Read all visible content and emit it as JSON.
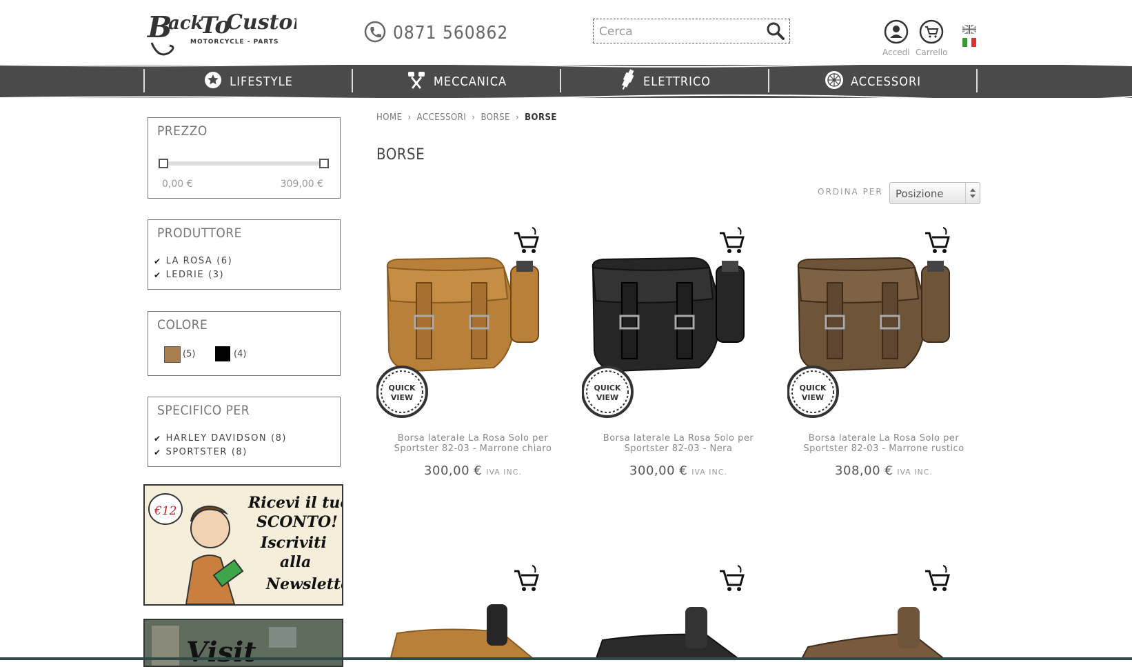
{
  "header": {
    "logo_text": "BackToCustom",
    "logo_tagline": "MOTORCYCLE - PARTS",
    "phone": "0871 560862",
    "search_placeholder": "Cerca",
    "account_label": "Accedi",
    "cart_label": "Carrello",
    "languages": [
      "en",
      "it"
    ]
  },
  "nav": {
    "items": [
      {
        "label": "LIFESTYLE",
        "icon": "star-badge-icon"
      },
      {
        "label": "MECCANICA",
        "icon": "crossed-pistons-icon"
      },
      {
        "label": "ELETTRICO",
        "icon": "spark-plug-icon"
      },
      {
        "label": "ACCESSORI",
        "icon": "wheel-icon"
      }
    ]
  },
  "sidebar": {
    "price": {
      "title": "PREZZO",
      "min": "0,00 €",
      "max": "309,00 €"
    },
    "manufacturer": {
      "title": "PRODUTTORE",
      "items": [
        {
          "label": "LA ROSA",
          "count": "(6)"
        },
        {
          "label": "LEDRIE",
          "count": "(3)"
        }
      ]
    },
    "color": {
      "title": "COLORE",
      "items": [
        {
          "color": "#a8804f",
          "count": "(5)"
        },
        {
          "color": "#000000",
          "count": "(4)"
        }
      ]
    },
    "specific": {
      "title": "SPECIFICO PER",
      "items": [
        {
          "label": "HARLEY DAVIDSON",
          "count": "(8)"
        },
        {
          "label": "SPORTSTER",
          "count": "(8)"
        }
      ]
    },
    "newsletter_banner": {
      "badge": "€12",
      "line1": "Ricevi il tuo",
      "line2": "SCONTO!",
      "line3": "Iscriviti",
      "line4": "alla",
      "line5": "Newsletter"
    },
    "visit_banner": {
      "text": "Visit"
    }
  },
  "main": {
    "breadcrumb": [
      "HOME",
      "ACCESSORI",
      "BORSE",
      "BORSE"
    ],
    "title": "BORSE",
    "sort_label": "ORDINA PER",
    "sort_value": "Posizione",
    "quick_view": "QUICK VIEW",
    "vat_label": "IVA INC.",
    "products": [
      {
        "name": "Borsa laterale La Rosa Solo per Sportster 82-03 - Marrone chiaro",
        "price": "300,00 €",
        "color": "#b9803a"
      },
      {
        "name": "Borsa laterale La Rosa Solo per Sportster 82-03 - Nera",
        "price": "300,00 €",
        "color": "#262626"
      },
      {
        "name": "Borsa laterale La Rosa Solo per Sportster 82-03 - Marrone rustico",
        "price": "308,00 €",
        "color": "#6e5438"
      }
    ]
  },
  "colors": {
    "nav_bg": "#4a4a4a",
    "text": "#555555"
  }
}
